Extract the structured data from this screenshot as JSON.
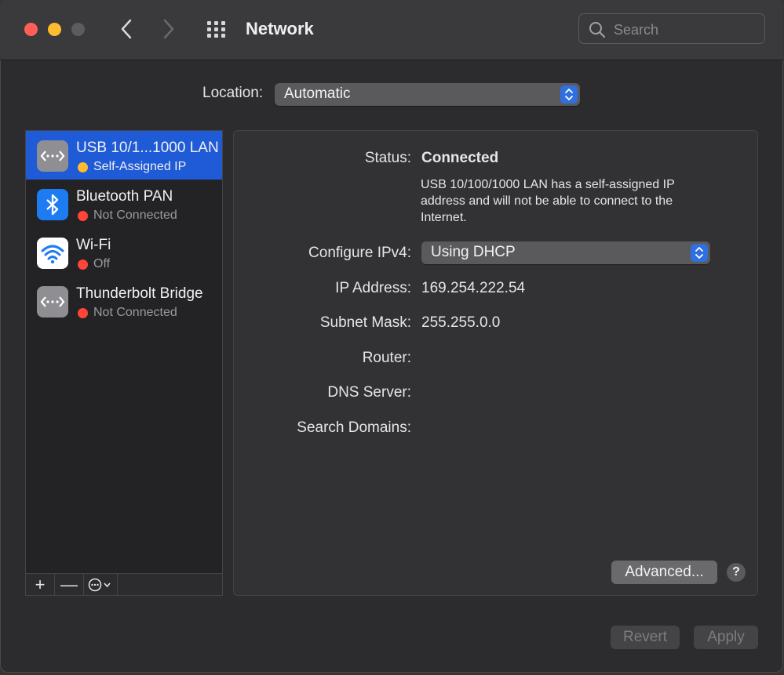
{
  "window": {
    "title": "Network",
    "search_placeholder": "Search"
  },
  "location": {
    "label": "Location:",
    "value": "Automatic"
  },
  "services": [
    {
      "name": "USB 10/1...1000 LAN",
      "status": "Self-Assigned IP",
      "status_color": "#febc2e",
      "icon": "ethernet-icon",
      "selected": true
    },
    {
      "name": "Bluetooth PAN",
      "status": "Not Connected",
      "status_color": "#ff453a",
      "icon": "bluetooth-icon",
      "selected": false
    },
    {
      "name": "Wi-Fi",
      "status": "Off",
      "status_color": "#ff453a",
      "icon": "wifi-icon",
      "selected": false
    },
    {
      "name": "Thunderbolt Bridge",
      "status": "Not Connected",
      "status_color": "#ff453a",
      "icon": "ethernet-icon",
      "selected": false
    }
  ],
  "sidebar_toolbar": {
    "add": "+",
    "remove": "—"
  },
  "detail": {
    "status_label": "Status:",
    "status_value": "Connected",
    "status_description": "USB 10/100/1000 LAN has a self-assigned IP address and will not be able to connect to the Internet.",
    "configure_label": "Configure IPv4:",
    "configure_value": "Using DHCP",
    "ip_label": "IP Address:",
    "ip_value": "169.254.222.54",
    "subnet_label": "Subnet Mask:",
    "subnet_value": "255.255.0.0",
    "router_label": "Router:",
    "router_value": "",
    "dns_label": "DNS Server:",
    "dns_value": "",
    "search_domains_label": "Search Domains:",
    "search_domains_value": "",
    "advanced_button": "Advanced...",
    "help_button": "?"
  },
  "footer": {
    "revert": "Revert",
    "apply": "Apply"
  },
  "colors": {
    "accent": "#2f6fe0",
    "selection": "#1f5bd6",
    "close": "#ff5f57",
    "minimize": "#febc2e"
  }
}
